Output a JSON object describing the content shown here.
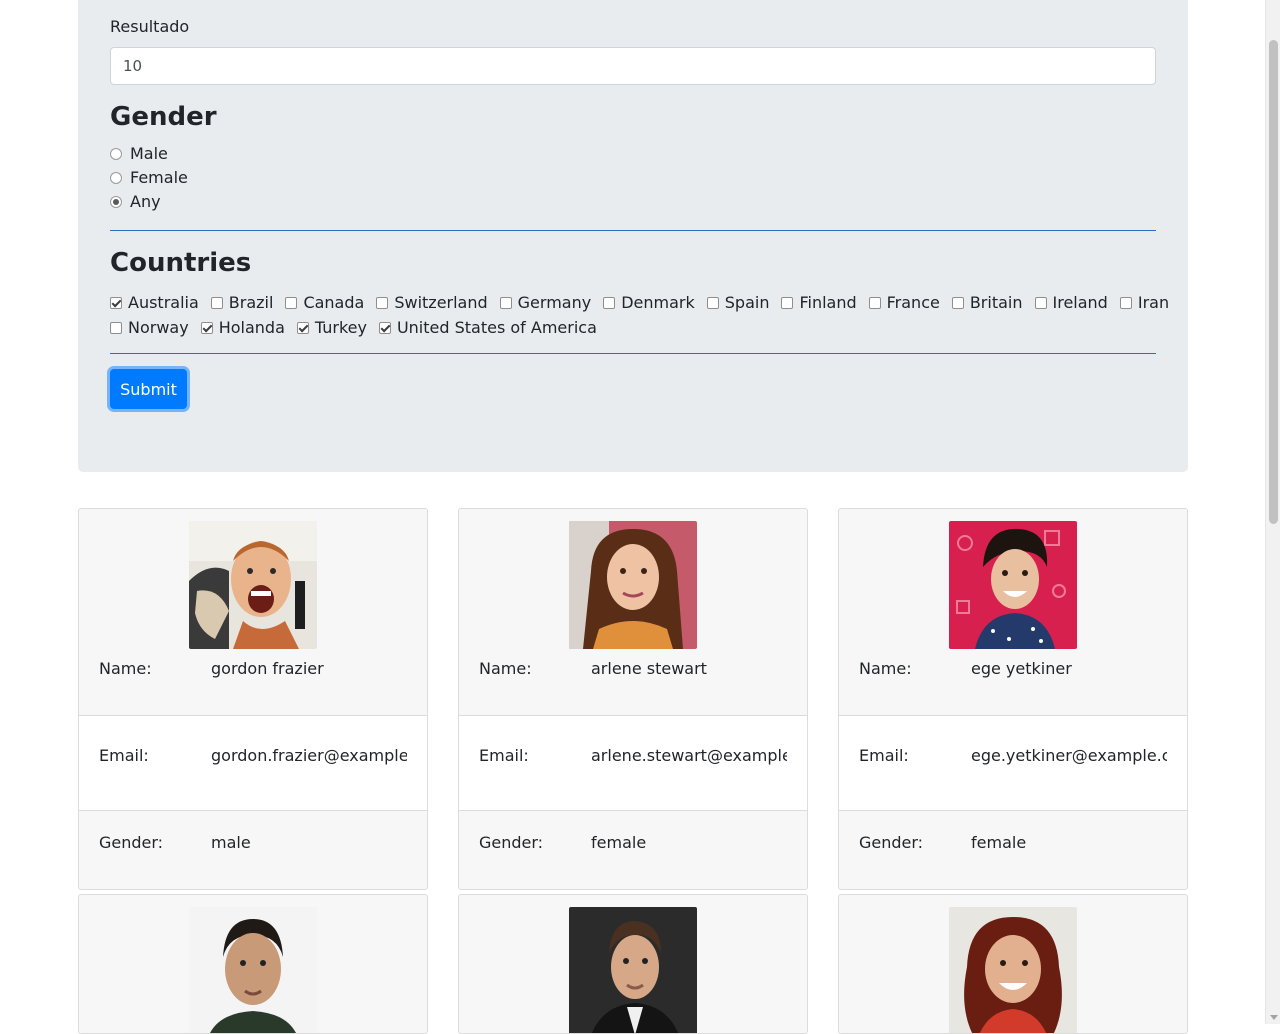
{
  "form": {
    "result_label": "Resultado",
    "result_value": "10",
    "gender_title": "Gender",
    "gender_options": [
      {
        "label": "Male",
        "checked": false
      },
      {
        "label": "Female",
        "checked": false
      },
      {
        "label": "Any",
        "checked": true
      }
    ],
    "countries_title": "Countries",
    "countries": [
      {
        "label": "Australia",
        "checked": true
      },
      {
        "label": "Brazil",
        "checked": false
      },
      {
        "label": "Canada",
        "checked": false
      },
      {
        "label": "Switzerland",
        "checked": false
      },
      {
        "label": "Germany",
        "checked": false
      },
      {
        "label": "Denmark",
        "checked": false
      },
      {
        "label": "Spain",
        "checked": false
      },
      {
        "label": "Finland",
        "checked": false
      },
      {
        "label": "France",
        "checked": false
      },
      {
        "label": "Britain",
        "checked": false
      },
      {
        "label": "Ireland",
        "checked": false
      },
      {
        "label": "Iran",
        "checked": false
      },
      {
        "label": "Norway",
        "checked": false
      },
      {
        "label": "Holanda",
        "checked": true
      },
      {
        "label": "Turkey",
        "checked": true
      },
      {
        "label": "United States of America",
        "checked": true
      }
    ],
    "submit_label": "Submit"
  },
  "labels": {
    "name": "Name:",
    "email": "Email:",
    "gender": "Gender:"
  },
  "cards": [
    {
      "name": "gordon frazier",
      "email": "gordon.frazier@example.com",
      "gender": "male"
    },
    {
      "name": "arlene stewart",
      "email": "arlene.stewart@example.com",
      "gender": "female"
    },
    {
      "name": "ege yetkiner",
      "email": "ege.yetkiner@example.com",
      "gender": "female"
    },
    {
      "name": "",
      "email": "",
      "gender": ""
    },
    {
      "name": "",
      "email": "",
      "gender": ""
    },
    {
      "name": "",
      "email": "",
      "gender": ""
    }
  ],
  "colors": {
    "primary": "#007bff",
    "panel_bg": "#e9ecef",
    "divider": "#2a6dc4"
  }
}
